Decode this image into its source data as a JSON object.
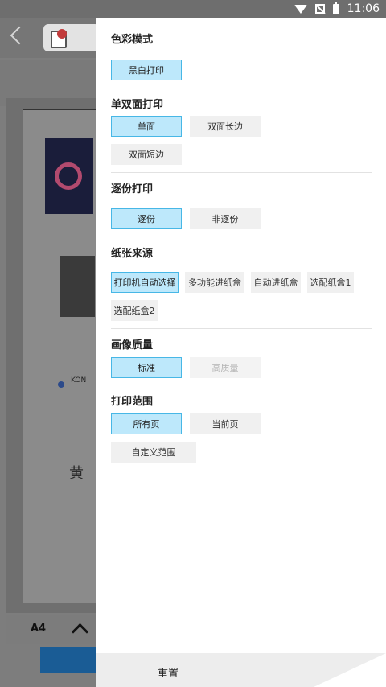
{
  "status_bar": {
    "time": "11:06"
  },
  "background_app": {
    "paper_size": "A4",
    "preview_text": "KON",
    "preview_glyph": "黄"
  },
  "drawer": {
    "sections": [
      {
        "title": "色彩模式",
        "options": [
          {
            "label": "黑白打印",
            "selected": true
          }
        ]
      },
      {
        "title": "单双面打印",
        "options": [
          {
            "label": "单面",
            "selected": true
          },
          {
            "label": "双面长边",
            "selected": false
          },
          {
            "label": "双面短边",
            "selected": false
          }
        ]
      },
      {
        "title": "逐份打印",
        "options": [
          {
            "label": "逐份",
            "selected": true
          },
          {
            "label": "非逐份",
            "selected": false
          }
        ]
      },
      {
        "title": "纸张来源",
        "options": [
          {
            "label": "打印机自动选择",
            "selected": true
          },
          {
            "label": "多功能进纸盒",
            "selected": false
          },
          {
            "label": "自动进纸盒",
            "selected": false
          },
          {
            "label": "选配纸盒1",
            "selected": false
          },
          {
            "label": "选配纸盒2",
            "selected": false
          }
        ]
      },
      {
        "title": "画像质量",
        "options": [
          {
            "label": "标准",
            "selected": true
          },
          {
            "label": "高质量",
            "selected": false,
            "disabled": true
          }
        ]
      },
      {
        "title": "打印范围",
        "options": [
          {
            "label": "所有页",
            "selected": true
          },
          {
            "label": "当前页",
            "selected": false
          },
          {
            "label": "自定义范围",
            "selected": false
          }
        ]
      }
    ],
    "reset_label": "重置"
  },
  "colors": {
    "selected_bg": "#bde8fb",
    "selected_border": "#47b7e6",
    "option_bg": "#f0f0f0",
    "accent_button": "#1a5c95"
  }
}
